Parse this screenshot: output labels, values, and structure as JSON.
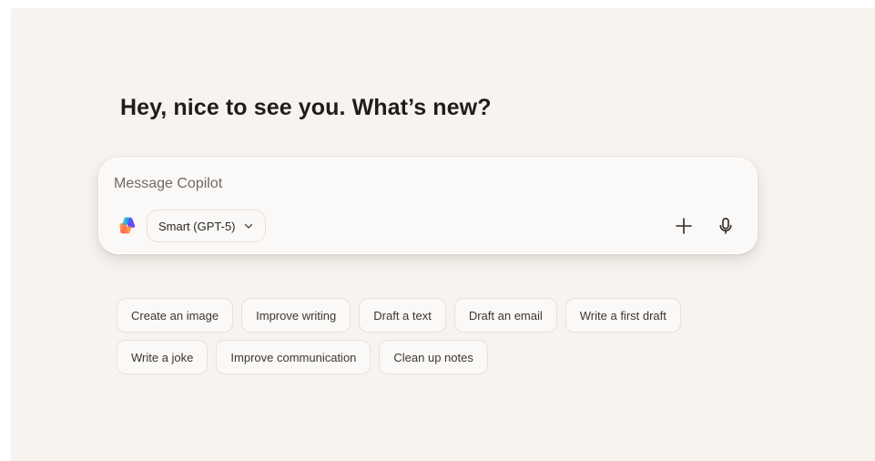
{
  "greeting": "Hey, nice to see you. What’s new?",
  "composer": {
    "placeholder": "Message Copilot",
    "model_label": "Smart (GPT-5)",
    "logo_icon": "copilot-logo-icon",
    "add_icon": "plus-icon",
    "mic_icon": "microphone-icon",
    "chevron_icon": "chevron-down-icon"
  },
  "suggestions": {
    "row1": [
      "Create an image",
      "Improve writing",
      "Draft a text",
      "Draft an email",
      "Write a first draft"
    ],
    "row2": [
      "Write a joke",
      "Improve communication",
      "Clean up notes"
    ]
  },
  "colors": {
    "background": "#f7f3ef",
    "surface": "#fbf9f7",
    "border": "#e6e1dc",
    "text": "#1f1d1b"
  }
}
